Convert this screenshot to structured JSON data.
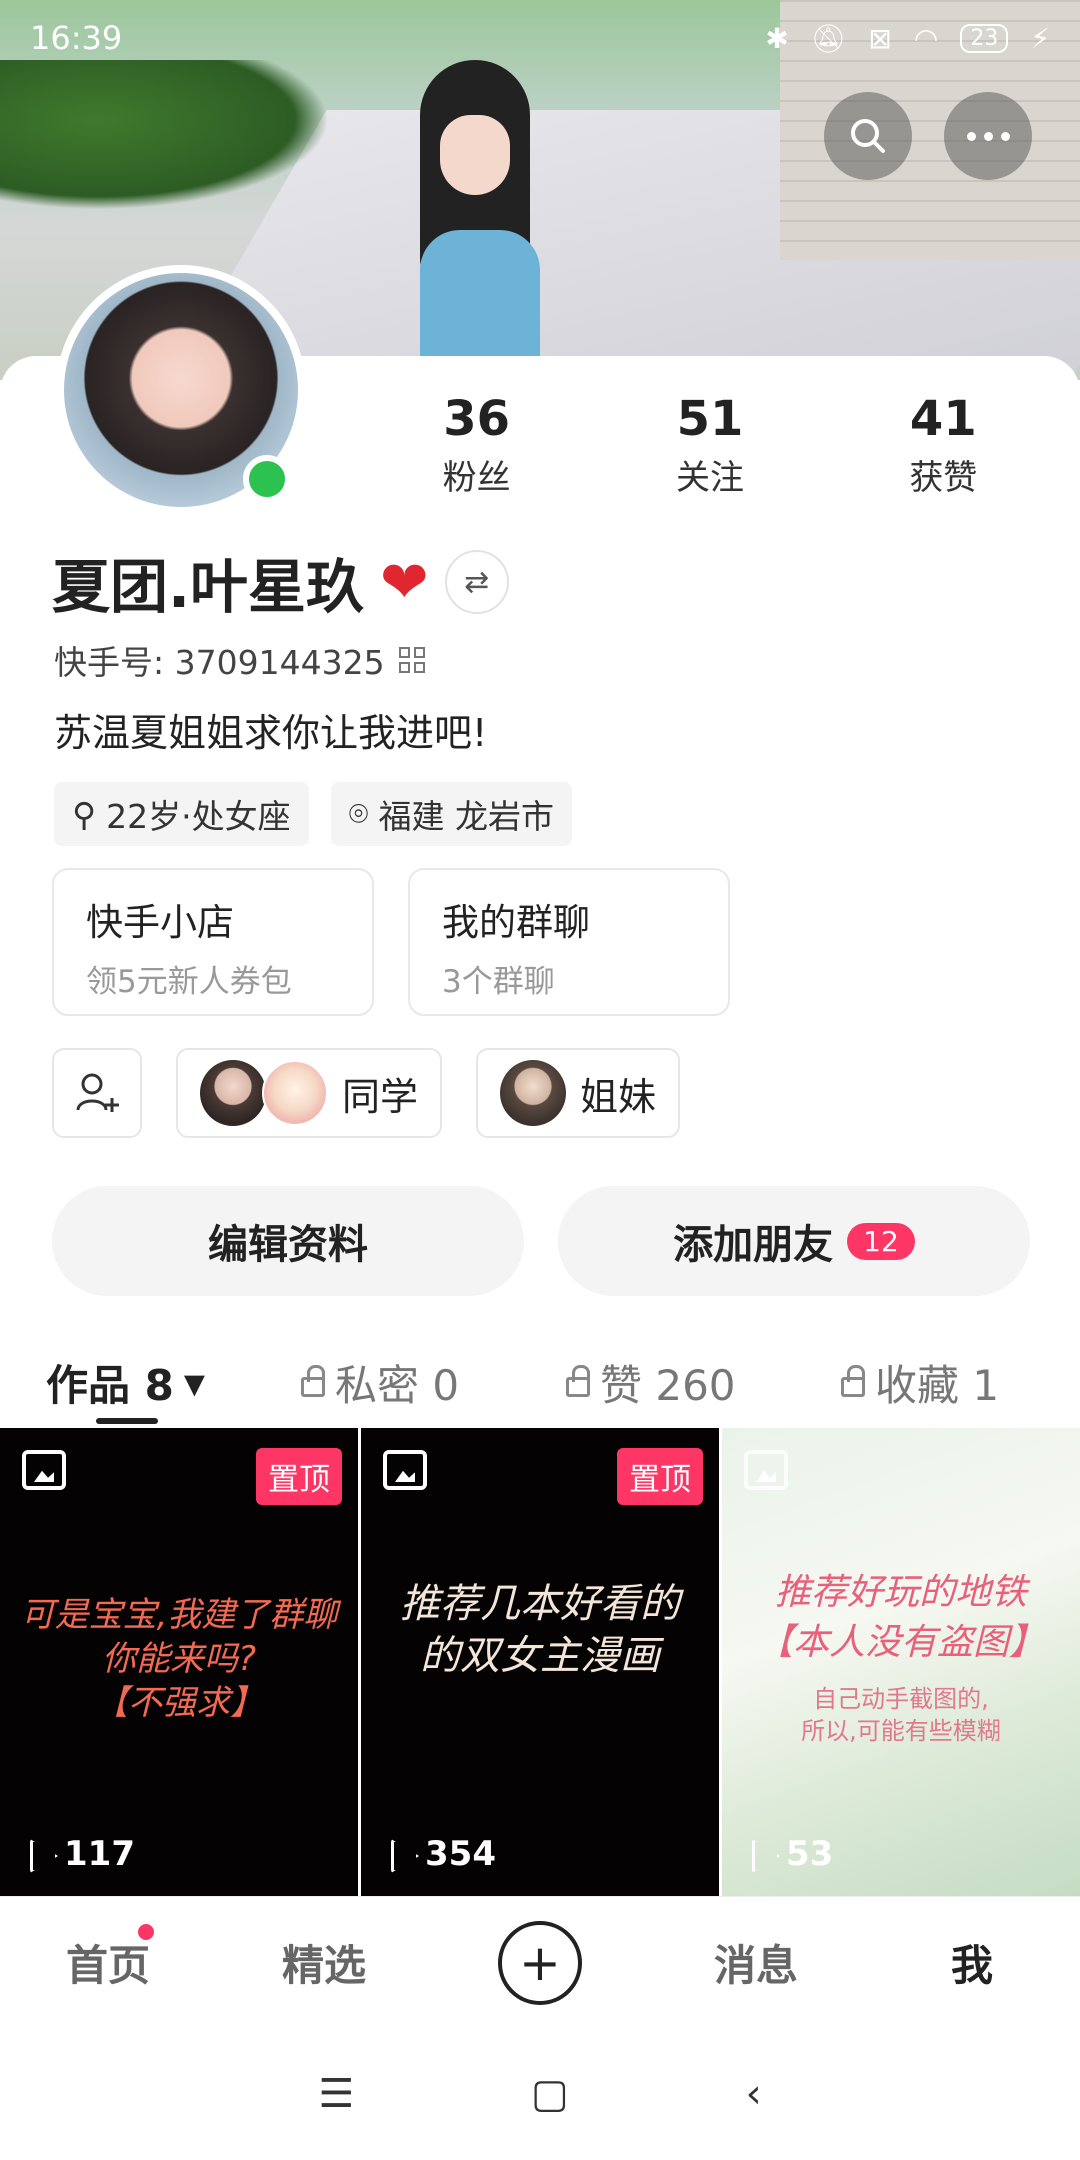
{
  "status_bar": {
    "time": "16:39",
    "battery": "23"
  },
  "header": {
    "search_icon": "search-icon",
    "more_icon": "more-icon"
  },
  "profile": {
    "stats": [
      {
        "num": "36",
        "label": "粉丝"
      },
      {
        "num": "51",
        "label": "关注"
      },
      {
        "num": "41",
        "label": "获赞"
      }
    ],
    "name": "夏团.叶星玖",
    "heart": "❤",
    "id_label": "快手号: 3709144325",
    "bio": "苏温夏姐姐求你让我进吧!",
    "tags": [
      {
        "icon": "gender-icon",
        "label": "22岁·处女座"
      },
      {
        "icon": "location-icon",
        "label": "福建 龙岩市"
      }
    ],
    "cards": [
      {
        "title": "快手小店",
        "sub": "领5元新人券包"
      },
      {
        "title": "我的群聊",
        "sub": "3个群聊"
      }
    ],
    "groups": [
      {
        "label": "同学"
      },
      {
        "label": "姐妹"
      }
    ],
    "actions": {
      "edit": "编辑资料",
      "add_friend": "添加朋友",
      "add_friend_badge": "12"
    }
  },
  "tabs": [
    {
      "label": "作品 8",
      "arrow": "▾"
    },
    {
      "label": "私密 0"
    },
    {
      "label": "赞 260"
    },
    {
      "label": "收藏 1"
    }
  ],
  "posts": [
    {
      "pin": "置顶",
      "text": "可是宝宝,我建了群聊\n你能来吗?\n【不强求】",
      "plays": "117"
    },
    {
      "pin": "置顶",
      "text": "推荐几本好看的\n的双女主漫画",
      "plays": "354"
    },
    {
      "text": "推荐好玩的地铁\n【本人没有盗图】",
      "sub": "自己动手截图的,\n所以,可能有些模糊",
      "plays": "53"
    }
  ],
  "bottom_nav": [
    {
      "label": "首页"
    },
    {
      "label": "精选"
    },
    {
      "label": "+"
    },
    {
      "label": "消息"
    },
    {
      "label": "我"
    }
  ],
  "colors": {
    "accent": "#fe3666",
    "online": "#2dc24f"
  }
}
